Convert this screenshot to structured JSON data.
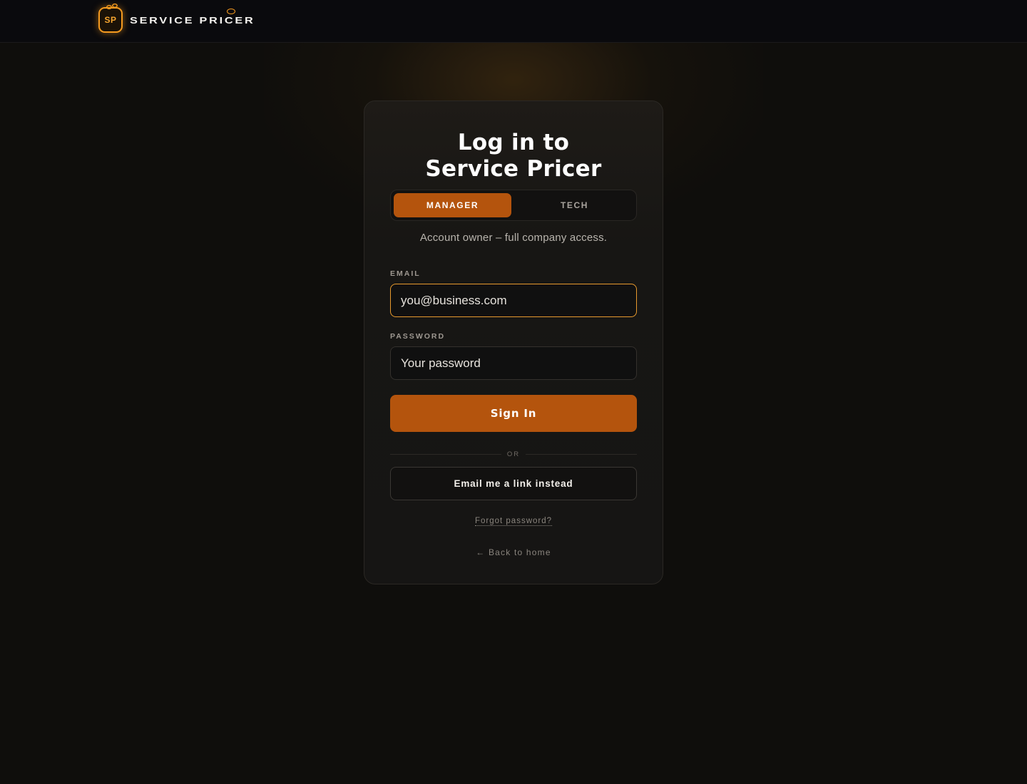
{
  "brand": {
    "logo_text": "SP",
    "name": "SERVICE PRICER",
    "accent": "#f59a1f"
  },
  "card": {
    "title_line1": "Log in to",
    "title_line2": "Service Pricer",
    "tabs": [
      {
        "label": "MANAGER",
        "selected": true
      },
      {
        "label": "TECH",
        "selected": false
      }
    ],
    "description": "Account owner – full company access.",
    "email": {
      "label": "EMAIL",
      "placeholder": "you@business.com",
      "value": ""
    },
    "password": {
      "label": "PASSWORD",
      "placeholder": "Your password",
      "value": ""
    },
    "signin_label": "Sign In",
    "or_label": "OR",
    "magic_link_label": "Email me a link instead",
    "forgot_label": "Forgot password?",
    "back_label": "← Back to home"
  },
  "colors": {
    "primary": "#b4540d",
    "focus_border": "#e79a2e",
    "background": "#0f0e0c"
  }
}
